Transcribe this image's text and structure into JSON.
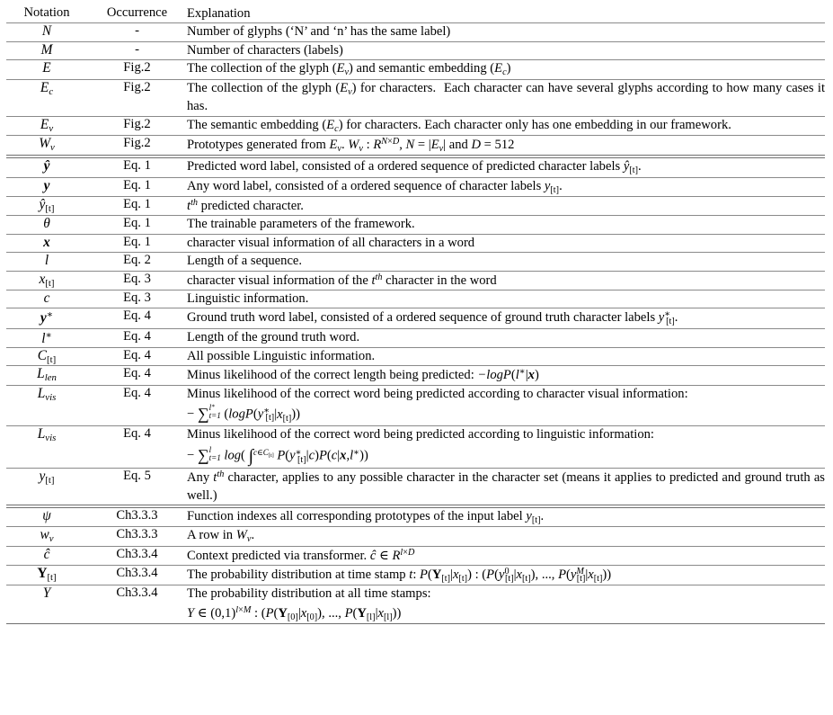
{
  "table": {
    "headers": {
      "notation": "Notation",
      "occurrence": "Occurrence",
      "explanation": "Explanation"
    },
    "rows": [
      {
        "notation": "N",
        "occurrence": "-",
        "explanation": "Number of glyphs (‘N’ and ‘n’ has the same label)"
      },
      {
        "notation": "M",
        "occurrence": "-",
        "explanation": "Number of characters (labels)"
      },
      {
        "notation": "E",
        "occurrence": "Fig.2",
        "explanation": "The collection of the glyph (E_v) and semantic embedding (E_c)"
      },
      {
        "notation": "E_c",
        "occurrence": "Fig.2",
        "explanation": "The collection of the glyph (E_v) for characters.  Each character can have several glyphs according to how many cases it has."
      },
      {
        "notation": "E_v",
        "occurrence": "Fig.2",
        "explanation": "The semantic embedding (E_c) for characters. Each character only has one embedding in our framework."
      },
      {
        "notation": "W_v",
        "occurrence": "Fig.2",
        "explanation": "Prototypes generated from E_v. W_v : R^{N×D}, N = |E_v| and D = 512"
      },
      {
        "notation": "ŷ",
        "occurrence": "Eq. 1",
        "explanation": "Predicted word label, consisted of a ordered sequence of predicted character labels ŷ_[t]."
      },
      {
        "notation": "y",
        "occurrence": "Eq. 1",
        "explanation": "Any word label, consisted of a ordered sequence of character labels y_[t]."
      },
      {
        "notation": "ŷ_[t]",
        "occurrence": "Eq. 1",
        "explanation": "t^th predicted character."
      },
      {
        "notation": "θ",
        "occurrence": "Eq. 1",
        "explanation": "The trainable parameters of the framework."
      },
      {
        "notation": "x",
        "occurrence": "Eq. 1",
        "explanation": "character visual information of all characters in a word"
      },
      {
        "notation": "l",
        "occurrence": "Eq. 2",
        "explanation": "Length of a sequence."
      },
      {
        "notation": "x_[t]",
        "occurrence": "Eq. 3",
        "explanation": "character visual information of the t^th character in the word"
      },
      {
        "notation": "c",
        "occurrence": "Eq. 3",
        "explanation": "Linguistic information."
      },
      {
        "notation": "y*",
        "occurrence": "Eq. 4",
        "explanation": "Ground truth word label, consisted of a ordered sequence of ground truth character labels y*_[t]."
      },
      {
        "notation": "l*",
        "occurrence": "Eq. 4",
        "explanation": "Length of the ground truth word."
      },
      {
        "notation": "C_[t]",
        "occurrence": "Eq. 4",
        "explanation": "All possible Linguistic information."
      },
      {
        "notation": "L_len",
        "occurrence": "Eq. 4",
        "explanation": "Minus likelihood of the correct length being predicted: −logP(l*|x)"
      },
      {
        "notation": "L_vis",
        "occurrence": "Eq. 4",
        "explanation": "Minus likelihood of the correct word being predicted according to character visual information: − Σ_{t=1}^{l*} (logP(y*_[t]|x_[t]))"
      },
      {
        "notation": "L_vis",
        "occurrence": "Eq. 4",
        "explanation": "Minus likelihood of the correct word being predicted according to linguistic information: − Σ_{t=1}^{l} log( ∫^{c∈C_[t]} P(y*_[t]|c)P(c|x,l*))"
      },
      {
        "notation": "y_[t]",
        "occurrence": "Eq. 5",
        "explanation": "Any t^th character, applies to any possible character in the character set (means it applies to predicted and ground truth as well.)"
      },
      {
        "notation": "ψ",
        "occurrence": "Ch3.3.3",
        "explanation": "Function indexes all corresponding prototypes of the input label y_[t]."
      },
      {
        "notation": "w_v",
        "occurrence": "Ch3.3.3",
        "explanation": "A row in W_v."
      },
      {
        "notation": "ĉ",
        "occurrence": "Ch3.3.4",
        "explanation": "Context predicted via transformer. ĉ ∈ R^{l×D}"
      },
      {
        "notation": "Y_[t]",
        "occurrence": "Ch3.3.4",
        "explanation": "The probability distribution at time stamp t: P(Y_[t]|x_[t]) : (P(y^0_[t]|x_[t]), ..., P(y^M_[t]|x_[t]))"
      },
      {
        "notation": "Y",
        "occurrence": "Ch3.3.4",
        "explanation": "The probability distribution at all time stamps: Y ∈ (0,1)^{l×M} : (P(Y_[0]|x_[0]), ..., P(Y_[l]|x_[l]))"
      }
    ]
  }
}
